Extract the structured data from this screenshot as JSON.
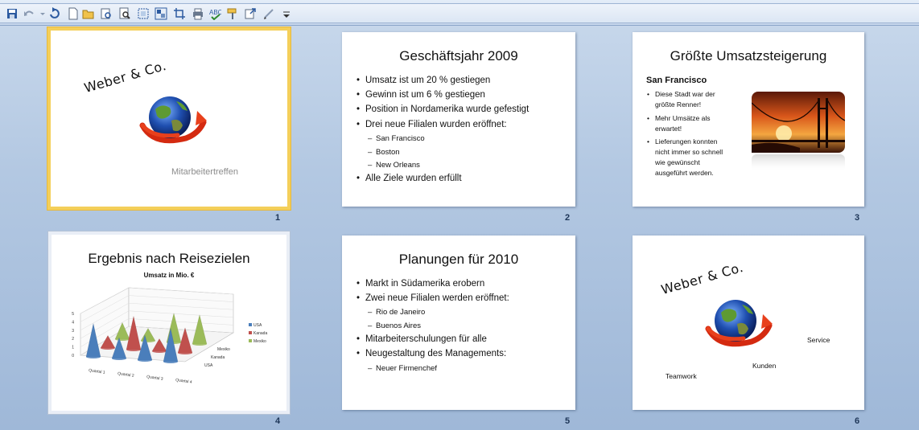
{
  "toolbar": {
    "buttons": [
      "save-icon",
      "undo-icon",
      "undo-dropdown-icon",
      "redo-icon",
      "new-icon",
      "open-icon",
      "print-preview-icon",
      "preview-icon",
      "select-icon",
      "group-icon",
      "crop-icon",
      "print-icon",
      "spelling-icon",
      "format-painter-icon",
      "export-icon",
      "pen-icon",
      "customize-icon"
    ]
  },
  "slides": [
    {
      "number": "1",
      "logo": "Weber & Co.",
      "subtitle": "Mitarbeitertreffen"
    },
    {
      "number": "2",
      "title": "Geschäftsjahr 2009",
      "bullets": [
        "Umsatz ist um 20 % gestiegen",
        "Gewinn ist um 6 % gestiegen",
        "Position in Nordamerika wurde gefestigt",
        "Drei neue Filialen wurden eröffnet:"
      ],
      "sub": [
        "San Francisco",
        "Boston",
        "New Orleans"
      ],
      "last": "Alle Ziele wurden erfüllt"
    },
    {
      "number": "3",
      "title": "Größte Umsatzsteigerung",
      "heading": "San Francisco",
      "bullets": [
        [
          "Diese Stadt war der",
          "größte Renner!"
        ],
        [
          "Mehr Umsätze als",
          "erwartet!"
        ],
        [
          "Lieferungen konnten",
          "nicht immer so schnell",
          "wie gewünscht",
          "ausgeführt werden."
        ]
      ]
    },
    {
      "number": "4",
      "title": "Ergebnis nach Reisezielen",
      "chart_title": "Umsatz in Mio. €"
    },
    {
      "number": "5",
      "title": "Planungen für 2010",
      "bullets": [
        "Markt in Südamerika erobern",
        "Zwei neue Filialen werden eröffnet:"
      ],
      "sub": [
        "Rio de Janeiro",
        "Buenos Aires"
      ],
      "bullets2": [
        "Mitarbeiterschulungen für alle",
        "Neugestaltung des Managements:"
      ],
      "sub2": [
        "Neuer Firmenchef"
      ]
    },
    {
      "number": "6",
      "logo": "Weber & Co.",
      "labels": [
        "Service",
        "Kunden",
        "Teamwork"
      ]
    }
  ],
  "chart_data": {
    "type": "bar",
    "title": "Umsatz in Mio. €",
    "categories": [
      "Quartal 1",
      "Quartal 2",
      "Quartal 3",
      "Quartal 4"
    ],
    "series": [
      {
        "name": "USA",
        "color": "#4a7ebb",
        "values": [
          4,
          2.5,
          3,
          4
        ]
      },
      {
        "name": "Kanada",
        "color": "#c0504d",
        "values": [
          1.5,
          4,
          1.5,
          3
        ]
      },
      {
        "name": "Mexiko",
        "color": "#9bbb59",
        "values": [
          2,
          1.5,
          3.5,
          3.5
        ]
      }
    ],
    "depth_labels": [
      "Mexiko",
      "Kanada",
      "USA"
    ],
    "ylim": [
      0,
      5
    ],
    "yticks": [
      "0",
      "1",
      "2",
      "3",
      "4",
      "5"
    ],
    "legend": "right"
  }
}
